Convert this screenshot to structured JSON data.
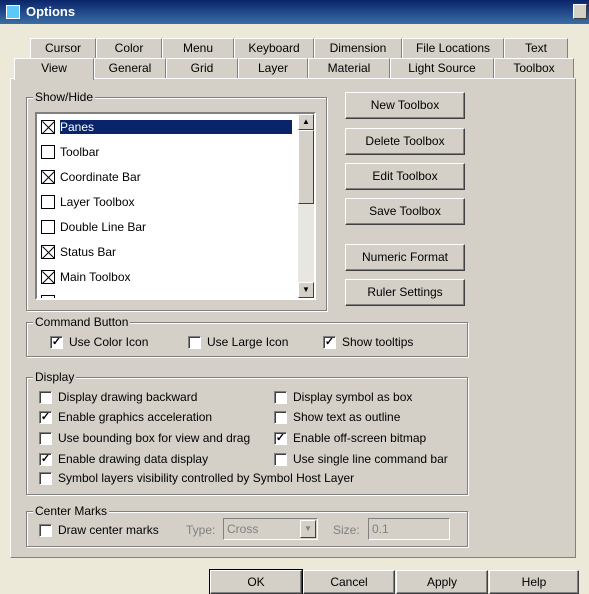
{
  "window": {
    "title": "Options",
    "close_icon": "close-icon"
  },
  "tabs_back": [
    "Cursor",
    "Color",
    "Menu",
    "Keyboard",
    "Dimension",
    "File Locations",
    "Text"
  ],
  "tabs_front": [
    "View",
    "General",
    "Grid",
    "Layer",
    "Material",
    "Light Source",
    "Toolbox"
  ],
  "active_tab": "View",
  "show_hide": {
    "legend": "Show/Hide",
    "items": [
      {
        "label": "Panes",
        "checked": true,
        "selected": true
      },
      {
        "label": "Toolbar",
        "checked": false
      },
      {
        "label": "Coordinate Bar",
        "checked": true
      },
      {
        "label": "Layer Toolbox",
        "checked": false
      },
      {
        "label": "Double Line Bar",
        "checked": false
      },
      {
        "label": "Status Bar",
        "checked": true
      },
      {
        "label": "Main Toolbox",
        "checked": true
      }
    ]
  },
  "side_buttons": [
    "New Toolbox",
    "Delete Toolbox",
    "Edit Toolbox",
    "Save Toolbox",
    "Numeric Format",
    "Ruler Settings"
  ],
  "command_button": {
    "legend": "Command Button",
    "options": [
      {
        "label": "Use Color Icon",
        "checked": true
      },
      {
        "label": "Use Large Icon",
        "checked": false
      },
      {
        "label": "Show tooltips",
        "checked": true
      }
    ]
  },
  "display": {
    "legend": "Display",
    "left": [
      {
        "label": "Display drawing backward",
        "checked": false
      },
      {
        "label": "Enable graphics acceleration",
        "checked": true
      },
      {
        "label": "Use bounding box for view and drag",
        "checked": false
      },
      {
        "label": "Enable drawing data display",
        "checked": true
      },
      {
        "label": "Symbol layers visibility controlled by Symbol Host Layer",
        "checked": false
      }
    ],
    "right": [
      {
        "label": "Display symbol as box",
        "checked": false
      },
      {
        "label": "Show text as outline",
        "checked": false
      },
      {
        "label": "Enable off-screen bitmap",
        "checked": true
      },
      {
        "label": "Use single line command bar",
        "checked": false
      }
    ]
  },
  "center_marks": {
    "legend": "Center Marks",
    "draw_label": "Draw center marks",
    "draw_checked": false,
    "type_label": "Type:",
    "type_value": "Cross",
    "size_label": "Size:",
    "size_value": "0.1"
  },
  "footer": {
    "ok": "OK",
    "cancel": "Cancel",
    "apply": "Apply",
    "help": "Help"
  }
}
